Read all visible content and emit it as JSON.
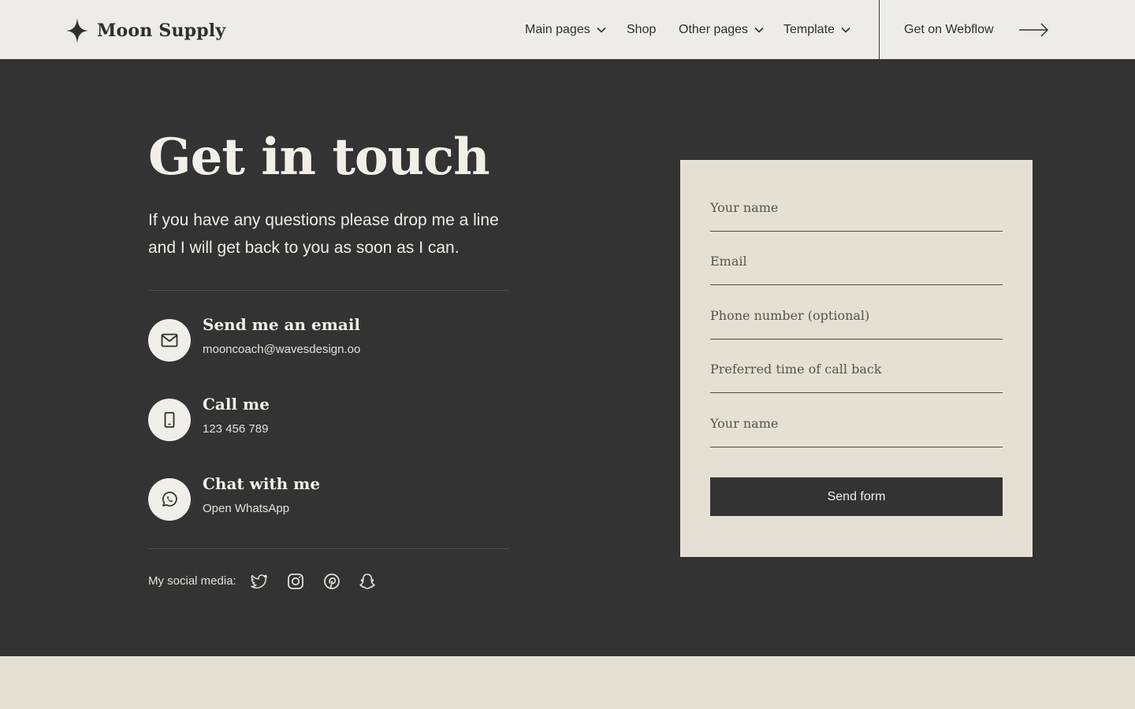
{
  "brand": {
    "name": "Moon Supply",
    "icon": "star-sparkle-icon"
  },
  "nav": {
    "main_pages": "Main pages",
    "shop": "Shop",
    "other_pages": "Other pages",
    "template": "Template",
    "cta": "Get on Webflow"
  },
  "hero": {
    "title": "Get in touch",
    "subtitle": "If you have any questions please drop me a line and I will get back to you as soon as I can."
  },
  "contacts": [
    {
      "title": "Send me an email",
      "value": "mooncoach@wavesdesign.oo",
      "icon": "envelope-icon"
    },
    {
      "title": "Call me",
      "value": "123 456 789",
      "icon": "phone-icon"
    },
    {
      "title": "Chat with me",
      "value": "Open WhatsApp",
      "icon": "whatsapp-icon"
    }
  ],
  "social": {
    "label": "My social media:",
    "icons": [
      "twitter-icon",
      "instagram-icon",
      "pinterest-icon",
      "snapchat-icon"
    ]
  },
  "form": {
    "fields": [
      "Your name",
      "Email",
      "Phone number (optional)",
      "Preferred time of call back",
      "Your name"
    ],
    "submit": "Send form"
  },
  "colors": {
    "dark": "#333333",
    "light": "#eeece8",
    "card": "#e4e1d4",
    "text_light": "#f1efe8",
    "text_dark": "#2f2f2f"
  }
}
